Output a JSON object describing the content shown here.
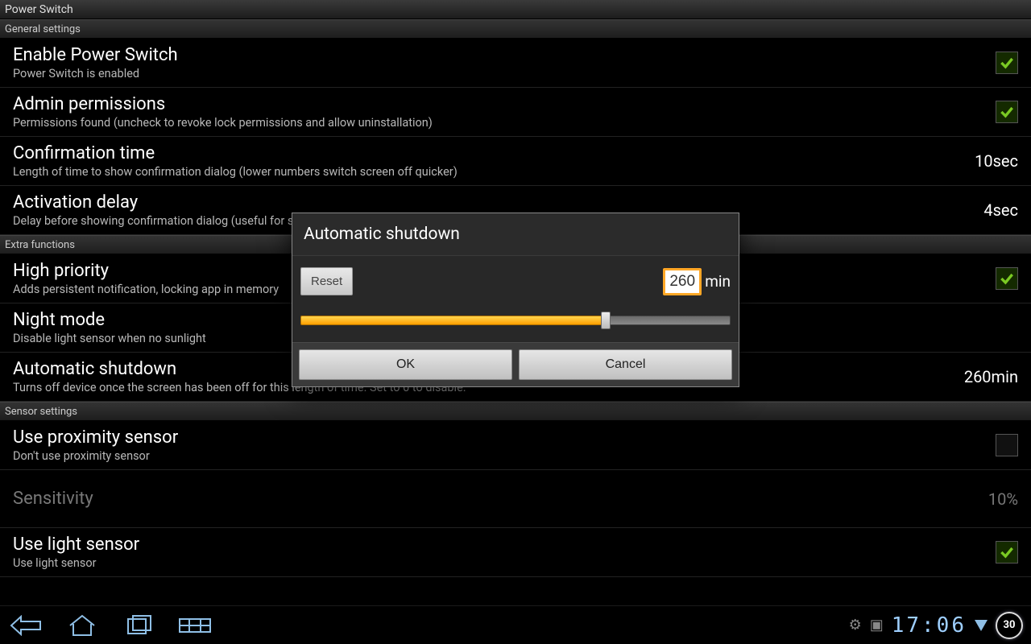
{
  "app_title": "Power Switch",
  "sections": {
    "general": {
      "header": "General settings",
      "enable": {
        "title": "Enable Power Switch",
        "sub": "Power Switch is enabled",
        "checked": true
      },
      "admin": {
        "title": "Admin permissions",
        "sub": "Permissions found (uncheck to revoke lock permissions and allow uninstallation)",
        "checked": true
      },
      "confirm": {
        "title": "Confirmation time",
        "sub": "Length of time to show confirmation dialog (lower numbers switch screen off quicker)",
        "value": "10sec"
      },
      "activation": {
        "title": "Activation delay",
        "sub": "Delay before showing confirmation dialog (useful for st",
        "value": "4sec"
      }
    },
    "extra": {
      "header": "Extra functions",
      "priority": {
        "title": "High priority",
        "sub": "Adds persistent notification, locking app in memory",
        "checked": true
      },
      "night": {
        "title": "Night mode",
        "sub": "Disable light sensor when no sunlight"
      },
      "auto": {
        "title": "Automatic shutdown",
        "sub": "Turns off device once the screen has been off for this length of time. Set to 0 to disable.",
        "value": "260min"
      }
    },
    "sensor": {
      "header": "Sensor settings",
      "prox": {
        "title": "Use proximity sensor",
        "sub": "Don't use proximity sensor",
        "checked": false
      },
      "sens": {
        "title": "Sensitivity",
        "value": "10%"
      },
      "light": {
        "title": "Use light sensor",
        "sub": "Use light sensor",
        "checked": true
      }
    }
  },
  "dialog": {
    "title": "Automatic shutdown",
    "reset": "Reset",
    "value": "260",
    "unit": "min",
    "percent": 71,
    "ok": "OK",
    "cancel": "Cancel"
  },
  "sysbar": {
    "clock": "17:06",
    "battery": "30"
  }
}
